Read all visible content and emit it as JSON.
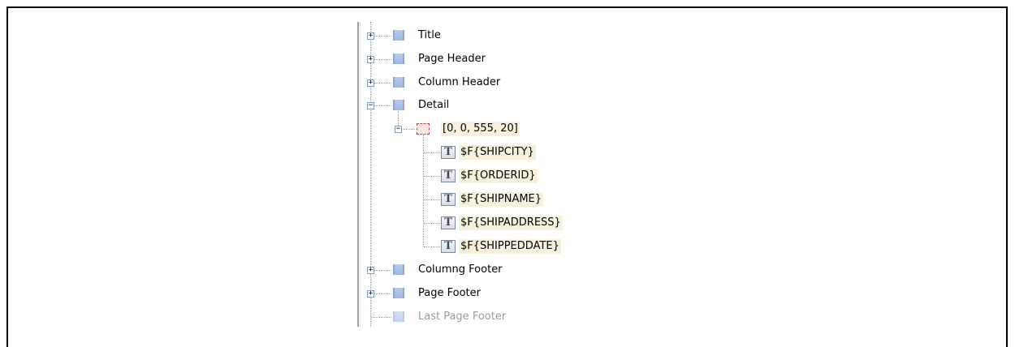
{
  "tree": {
    "bands": [
      {
        "label": "Title",
        "expander": "+"
      },
      {
        "label": "Page Header",
        "expander": "+"
      },
      {
        "label": "Column Header",
        "expander": "+"
      },
      {
        "label": "Detail",
        "expander": "−"
      },
      {
        "label": "Columng Footer",
        "expander": "+"
      },
      {
        "label": "Page Footer",
        "expander": "+"
      },
      {
        "label": "Last Page Footer",
        "expander": ""
      }
    ],
    "frame": {
      "label": "[0, 0, 555, 20]",
      "expander": "−"
    },
    "fields": [
      {
        "icon_text": "T",
        "label": "$F{SHIPCITY}"
      },
      {
        "icon_text": "T",
        "label": "$F{ORDERID}"
      },
      {
        "icon_text": "T",
        "label": "$F{SHIPNAME}"
      },
      {
        "icon_text": "T",
        "label": "$F{SHIPADDRESS}"
      },
      {
        "icon_text": "T",
        "label": "$F{SHIPPEDDATE}"
      }
    ]
  },
  "colors": {
    "band_icon": "#9fb6e0",
    "frame_icon_border": "#c04040",
    "field_highlight": "#f5f1dc",
    "disabled_text": "#9a9a9a"
  },
  "icons": {
    "band": "band-icon",
    "frame": "frame-element-icon",
    "text_field": "text-field-icon",
    "expand": "plus-expander-icon",
    "collapse": "minus-expander-icon"
  }
}
